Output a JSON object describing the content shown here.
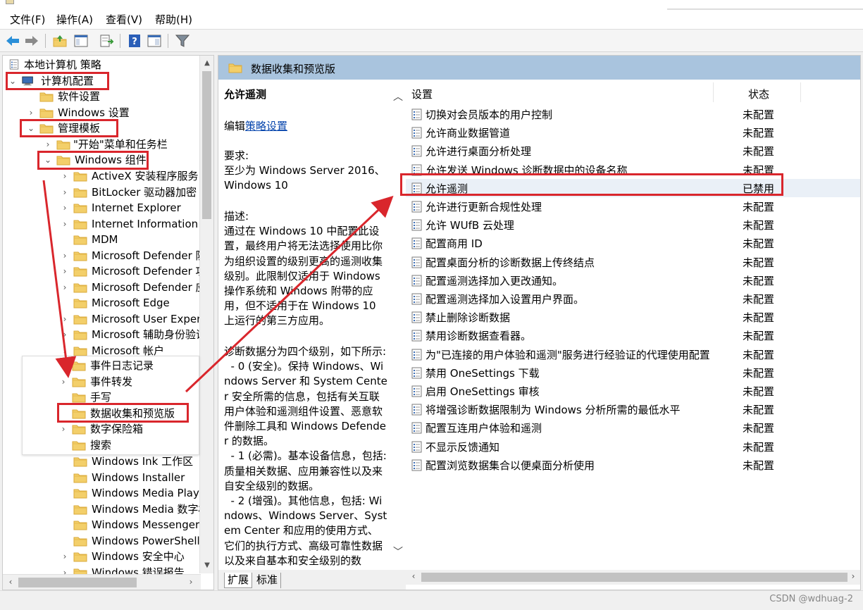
{
  "menu": {
    "file": "文件(F)",
    "action": "操作(A)",
    "view": "查看(V)",
    "help": "帮助(H)"
  },
  "tree": {
    "root": "本地计算机 策略",
    "computer_config": "计算机配置",
    "software_settings": "软件设置",
    "windows_settings": "Windows 设置",
    "admin_templates": "管理模板",
    "start_menu": "\"开始\"菜单和任务栏",
    "windows_components": "Windows 组件",
    "children_top": [
      "ActiveX 安装程序服务",
      "BitLocker 驱动器加密",
      "Internet Explorer",
      "Internet Information Se",
      "MDM",
      "Microsoft Defender 防",
      "Microsoft Defender 攻",
      "Microsoft Defender 应",
      "Microsoft Edge",
      "Microsoft User Experie",
      "Microsoft 辅助身份验证",
      "Microsoft 帐户"
    ],
    "popup_items": [
      "事件日志记录",
      "事件转发",
      "手写",
      "数据收集和预览版",
      "数字保险箱",
      "搜索"
    ],
    "children_bottom": [
      "Windows Ink 工作区",
      "Windows Installer",
      "Windows Media Player",
      "Windows Media 数字权",
      "Windows Messenger",
      "Windows PowerShell",
      "Windows 安全中心",
      "Windows 错误报告"
    ]
  },
  "header": {
    "folder_title": "数据收集和预览版"
  },
  "detail": {
    "title": "允许遥测",
    "edit_prefix": "编辑",
    "edit_link": "策略设置",
    "requirements": "要求:\n至少为 Windows Server 2016、Windows 10",
    "description": "描述:\n通过在 Windows 10 中配置此设置，最终用户将无法选择使用比你为组织设置的级别更高的遥测收集级别。此限制仅适用于 Windows 操作系统和 Windows 附带的应用，但不适用于在 Windows 10 上运行的第三方应用。",
    "levels": "诊断数据分为四个级别，如下所示:\n  - 0 (安全)。保持 Windows、Windows Server 和 System Center 安全所需的信息，包括有关互联用户体验和遥测组件设置、恶意软件删除工具和 Windows Defender 的数据。\n  - 1 (必需)。基本设备信息，包括: 质量相关数据、应用兼容性以及来自安全级别的数据。\n  - 2 (增强)。其他信息，包括: Windows、Windows Server、System Center 和应用的使用方式、它们的执行方式、高级可靠性数据以及来自基本和安全级别的数"
  },
  "list": {
    "col_setting": "设置",
    "col_state": "状态",
    "rows": [
      {
        "name": "切换对会员版本的用户控制",
        "state": "未配置"
      },
      {
        "name": "允许商业数据管道",
        "state": "未配置"
      },
      {
        "name": "允许进行桌面分析处理",
        "state": "未配置"
      },
      {
        "name": "允许发送 Windows 诊断数据中的设备名称",
        "state": "未配置"
      },
      {
        "name": "允许遥测",
        "state": "已禁用"
      },
      {
        "name": "允许进行更新合规性处理",
        "state": "未配置"
      },
      {
        "name": "允许 WUfB 云处理",
        "state": "未配置"
      },
      {
        "name": "配置商用 ID",
        "state": "未配置"
      },
      {
        "name": "配置桌面分析的诊断数据上传终结点",
        "state": "未配置"
      },
      {
        "name": "配置遥测选择加入更改通知。",
        "state": "未配置"
      },
      {
        "name": "配置遥测选择加入设置用户界面。",
        "state": "未配置"
      },
      {
        "name": "禁止删除诊断数据",
        "state": "未配置"
      },
      {
        "name": "禁用诊断数据查看器。",
        "state": "未配置"
      },
      {
        "name": "为\"已连接的用户体验和遥测\"服务进行经验证的代理使用配置",
        "state": "未配置"
      },
      {
        "name": "禁用 OneSettings 下载",
        "state": "未配置"
      },
      {
        "name": "启用 OneSettings 审核",
        "state": "未配置"
      },
      {
        "name": "将增强诊断数据限制为 Windows 分析所需的最低水平",
        "state": "未配置"
      },
      {
        "name": "配置互连用户体验和遥测",
        "state": "未配置"
      },
      {
        "name": "不显示反馈通知",
        "state": "未配置"
      },
      {
        "name": "配置浏览数据集合以便桌面分析使用",
        "state": "未配置"
      }
    ]
  },
  "tabs": {
    "extended": "扩展",
    "standard": "标准"
  },
  "watermark": "CSDN @wdhuag-2",
  "colors": {
    "annotation_red": "#d9262c",
    "header_band": "#a9c4de",
    "folder_yellow": "#f3cf6a"
  }
}
